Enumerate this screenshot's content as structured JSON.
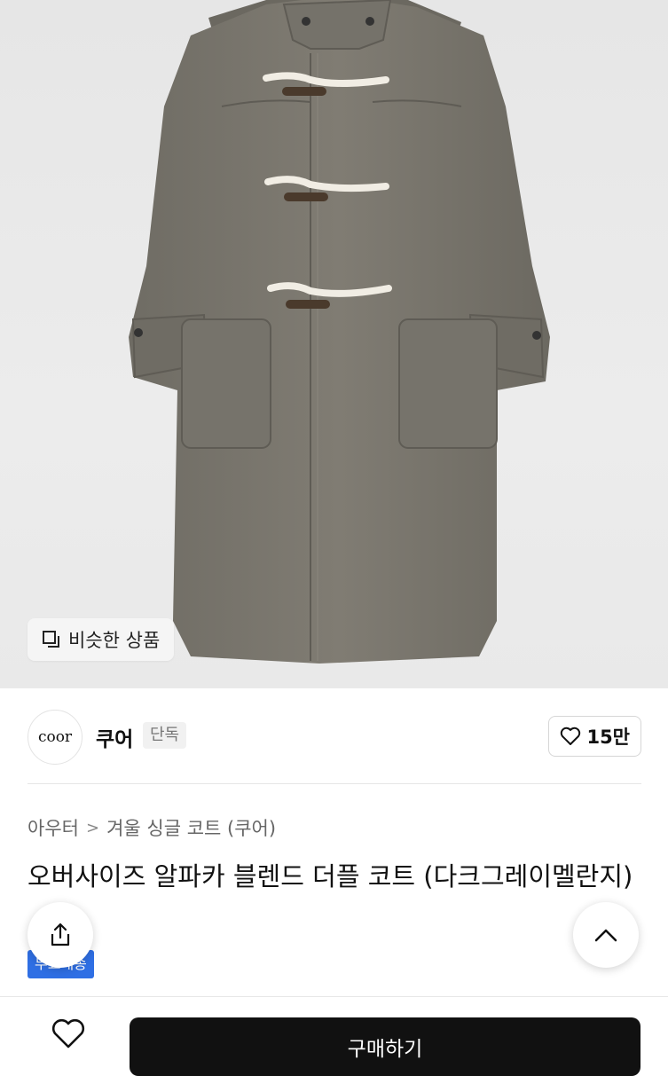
{
  "hero": {
    "similar_label": "비슷한 상품"
  },
  "brand": {
    "logo_text": "coor",
    "name": "쿠어",
    "badge": "단독",
    "like_count": "15만"
  },
  "breadcrumb": {
    "parent": "아우터",
    "child": "겨울 싱글 코트 (쿠어)"
  },
  "product": {
    "title": "오버사이즈 알파카 블렌드 더플 코트 (다크그레이멜란지)",
    "tag": "무료배송"
  },
  "bottom": {
    "buy_label": "구매하기"
  },
  "colors": {
    "primary_button": "#111111",
    "tag_blue": "#2f6fe4",
    "coat": "#7a776f"
  },
  "icons": [
    "similar-icon",
    "heart-icon",
    "chevron-right-icon",
    "share-icon",
    "chevron-up-icon"
  ]
}
